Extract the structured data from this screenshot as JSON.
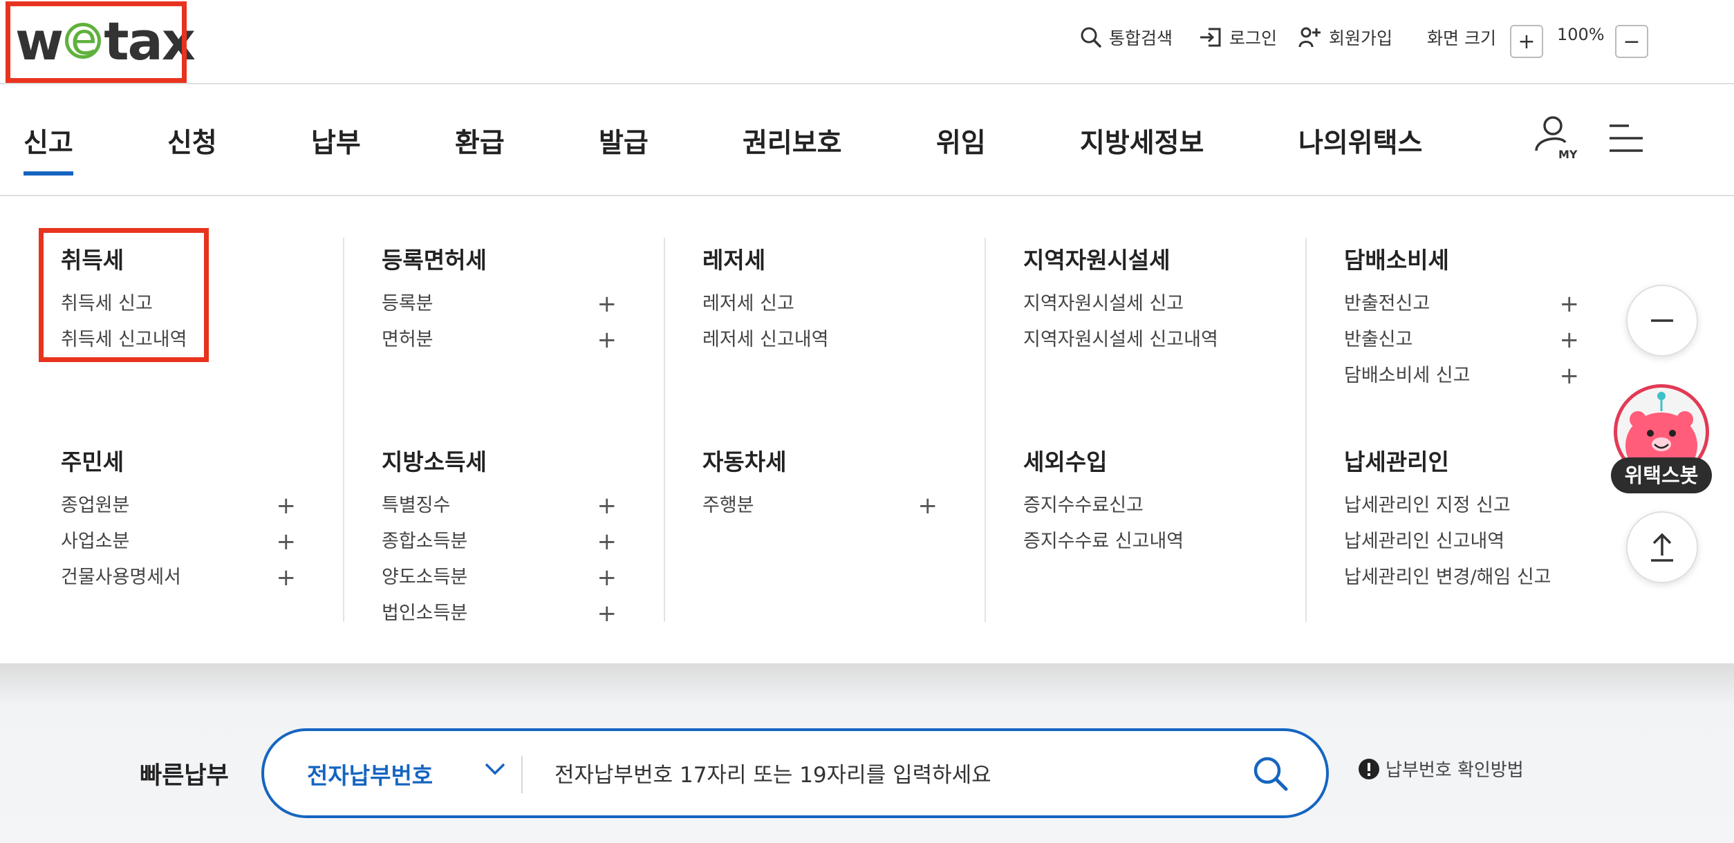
{
  "header": {
    "logo_text_w": "w",
    "logo_text_e": "e",
    "logo_text_tax": "tax",
    "search_label": "통합검색",
    "login_label": "로그인",
    "signup_label": "회원가입",
    "screen_size_label": "화면 크기",
    "zoom_in": "+",
    "zoom_value": "100%",
    "zoom_out": "−"
  },
  "nav": {
    "items": [
      "신고",
      "신청",
      "납부",
      "환급",
      "발급",
      "권리보호",
      "위임",
      "지방세정보",
      "나의위택스"
    ],
    "active_index": 0,
    "my_label": "MY"
  },
  "mega_menu": {
    "groups": [
      {
        "title": "취득세",
        "items": [
          {
            "label": "취득세 신고",
            "plus": ""
          },
          {
            "label": "취득세 신고내역",
            "plus": ""
          }
        ]
      },
      {
        "title": "등록면허세",
        "items": [
          {
            "label": "등록분",
            "plus": "+"
          },
          {
            "label": "면허분",
            "plus": "+"
          }
        ]
      },
      {
        "title": "레저세",
        "items": [
          {
            "label": "레저세 신고",
            "plus": ""
          },
          {
            "label": "레저세 신고내역",
            "plus": ""
          }
        ]
      },
      {
        "title": "지역자원시설세",
        "items": [
          {
            "label": "지역자원시설세 신고",
            "plus": ""
          },
          {
            "label": "지역자원시설세 신고내역",
            "plus": ""
          }
        ]
      },
      {
        "title": "담배소비세",
        "items": [
          {
            "label": "반출전신고",
            "plus": "+"
          },
          {
            "label": "반출신고",
            "plus": "+"
          },
          {
            "label": "담배소비세 신고",
            "plus": "+"
          }
        ]
      },
      {
        "title": "주민세",
        "items": [
          {
            "label": "종업원분",
            "plus": "+"
          },
          {
            "label": "사업소분",
            "plus": "+"
          },
          {
            "label": "건물사용명세서",
            "plus": "+"
          }
        ]
      },
      {
        "title": "지방소득세",
        "items": [
          {
            "label": "특별징수",
            "plus": "+"
          },
          {
            "label": "종합소득분",
            "plus": "+"
          },
          {
            "label": "양도소득분",
            "plus": "+"
          },
          {
            "label": "법인소득분",
            "plus": "+"
          }
        ]
      },
      {
        "title": "자동차세",
        "items": [
          {
            "label": "주행분",
            "plus": "+"
          }
        ]
      },
      {
        "title": "세외수입",
        "items": [
          {
            "label": "증지수수료신고",
            "plus": ""
          },
          {
            "label": "증지수수료 신고내역",
            "plus": ""
          }
        ]
      },
      {
        "title": "납세관리인",
        "items": [
          {
            "label": "납세관리인 지정 신고",
            "plus": ""
          },
          {
            "label": "납세관리인 신고내역",
            "plus": ""
          },
          {
            "label": "납세관리인 변경/해임 신고",
            "plus": ""
          }
        ]
      }
    ]
  },
  "floating": {
    "chatbot_label": "위택스봇",
    "collapse_icon": "minus-icon",
    "top_icon": "arrow-up-icon"
  },
  "quick_pay": {
    "label": "빠른납부",
    "select_value": "전자납부번호",
    "input_placeholder": "전자납부번호 17자리 또는 19자리를 입력하세요",
    "help_label": "납부번호 확인방법"
  },
  "colors": {
    "accent": "#1565c0",
    "highlight_box": "#e8331f",
    "logo_green": "#5fb13d",
    "chatbot_pink": "#e23a55"
  }
}
